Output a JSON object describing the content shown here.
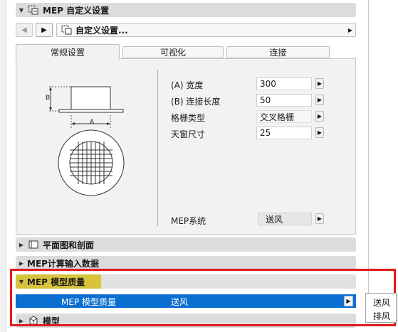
{
  "mep_custom": {
    "title": "MEP 自定义设置",
    "selector_label": "自定义设置...",
    "tabs": [
      "常规设置",
      "可视化",
      "连接"
    ],
    "diagram": {
      "label_a": "A",
      "label_b": "B"
    },
    "params": [
      {
        "label": "(A) 宽度",
        "value": "300"
      },
      {
        "label": "(B) 连接长度",
        "value": "50"
      },
      {
        "label": "格栅类型",
        "value": "交叉格栅"
      },
      {
        "label": "天窗尺寸",
        "value": "25"
      }
    ],
    "mep_system": {
      "label": "MEP系统",
      "value": "送风"
    }
  },
  "sections": {
    "floor_plan": "平面图和剖面",
    "mep_calc": "MEP计算输入数据",
    "mep_quality": "MEP 模型质量",
    "model": "模型"
  },
  "quality_row": {
    "label": "MEP 模型质量",
    "value": "送风"
  },
  "dropdown_options": [
    "送风",
    "排风"
  ],
  "colors": {
    "highlight_red": "#e01b1b",
    "selected_blue": "#0a6fd0",
    "quality_yellow": "#d8c43c"
  }
}
